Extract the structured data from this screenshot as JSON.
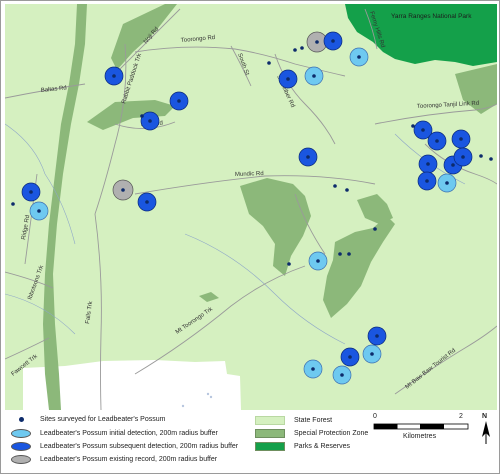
{
  "map": {
    "park_label": "Yarra Ranges National Park",
    "road_labels": [
      {
        "id": "noji-rd",
        "text": "Noji Rd"
      },
      {
        "id": "toorongo-rd",
        "text": "Toorongo Rd"
      },
      {
        "id": "south-st",
        "text": "South St"
      },
      {
        "id": "ferny-hills-rd",
        "text": "Ferny Hills Rd"
      },
      {
        "id": "baltas-rd",
        "text": "Baltas Rd"
      },
      {
        "id": "rabbit-paddock-trk",
        "text": "Rabbit Paddock Trk"
      },
      {
        "id": "falls-rd",
        "text": "Falls Rd"
      },
      {
        "id": "schreiber-rd",
        "text": "Schreiber Rd"
      },
      {
        "id": "toorongo-tanjil-link-rd",
        "text": "Toorongo Tanjil Link Rd"
      },
      {
        "id": "mundic-rd",
        "text": "Mundic Rd"
      },
      {
        "id": "ridge-rd",
        "text": "Ridge Rd"
      },
      {
        "id": "ibbotsons-trk",
        "text": "Ibbotsons Trk"
      },
      {
        "id": "falls-trk",
        "text": "Falls Trk"
      },
      {
        "id": "fawcett-trk",
        "text": "Fawcett Trk"
      },
      {
        "id": "mt-toorongo-trk",
        "text": "Mt Toorongo Trk"
      },
      {
        "id": "mt-baw-baw-tourist-rd",
        "text": "Mt Baw Baw Tourist Rd"
      }
    ]
  },
  "legend": {
    "sites": "Sites surveyed for Leadbeater's Possum",
    "initial": "Leadbeater's Possum initial detection, 200m radius buffer",
    "subsequent": "Leadbeater's Possum subsequent detection, 200m radius buffer",
    "existing": "Leadbeater's Possum existing record, 200m radius buffer",
    "state_forest": "State Forest",
    "spz": "Special Protection Zone",
    "parks": "Parks & Reserves"
  },
  "scale": {
    "start": "0",
    "end": "2",
    "unit": "Kilometres"
  },
  "north": "N",
  "colors": {
    "state_forest": "#d5f0c0",
    "spz": "#8cb87a",
    "parks": "#14a04a",
    "initial": "#6ec9f0",
    "subsequent": "#1a56e0",
    "existing": "#b0b0b0",
    "site": "#0d2b6b",
    "road": "#9a9a9a"
  }
}
